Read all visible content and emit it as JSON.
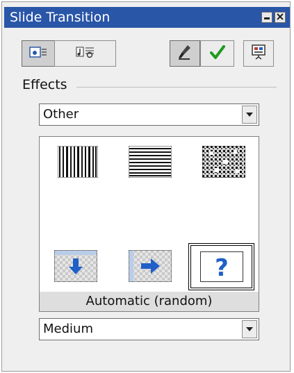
{
  "window": {
    "title": "Slide Transition",
    "minimize_icon": "minimize-icon",
    "close_icon": "close-icon"
  },
  "toolbar": {
    "buttons": [
      {
        "name": "transition-view-button",
        "icon": "slide-transition-icon",
        "pressed": true
      },
      {
        "name": "sound-view-button",
        "icon": "music-note-icon",
        "pressed": false
      },
      {
        "name": "preview-button",
        "icon": "brush-icon",
        "pressed": true
      },
      {
        "name": "apply-button",
        "icon": "checkmark-icon",
        "pressed": false
      },
      {
        "name": "slideshow-button",
        "icon": "slideshow-icon",
        "pressed": false
      }
    ]
  },
  "effects": {
    "label": "Effects",
    "category": "Other",
    "items": [
      {
        "name": "vertical-stripes",
        "icon": "vertical-stripes-icon"
      },
      {
        "name": "horizontal-stripes",
        "icon": "horizontal-stripes-icon"
      },
      {
        "name": "dissolve",
        "icon": "dissolve-icon"
      },
      {
        "name": "cover-down",
        "icon": "arrow-down-icon"
      },
      {
        "name": "cover-right",
        "icon": "arrow-right-icon"
      },
      {
        "name": "automatic-random",
        "icon": "question-mark-icon",
        "selected": true
      }
    ],
    "selected_caption": "Automatic (random)",
    "random_glyph": "?",
    "speed": "Medium"
  },
  "colors": {
    "titlebar": "#2a56a8",
    "accent_blue": "#1f5fc7",
    "check_green": "#1e9b1e"
  }
}
